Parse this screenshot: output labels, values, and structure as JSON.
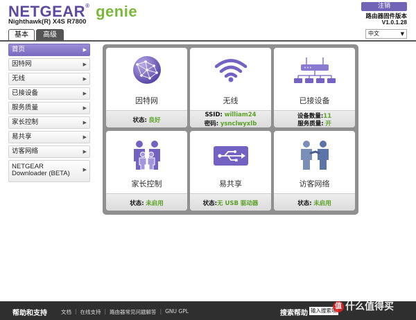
{
  "header": {
    "brand": "NETGEAR",
    "brand_reg": "®",
    "brand_genie": "genie",
    "model": "Nighthawk(R) X4S R7800",
    "logout": "注销",
    "firmware_label": "路由器固件版本",
    "firmware_version": "V1.0.1.28",
    "language": "中文"
  },
  "tabs": [
    {
      "label": "基本",
      "active": true
    },
    {
      "label": "高级",
      "active": false
    }
  ],
  "sidebar": {
    "items": [
      {
        "label": "首页",
        "active": true
      },
      {
        "label": "因特网"
      },
      {
        "label": "无线"
      },
      {
        "label": "已接设备"
      },
      {
        "label": "服务质量"
      },
      {
        "label": "家长控制"
      },
      {
        "label": "易共享"
      },
      {
        "label": "访客网络"
      },
      {
        "label_line1": "NETGEAR",
        "label_line2": "Downloader (BETA)"
      }
    ]
  },
  "tiles": {
    "internet": {
      "title": "因特网",
      "status_key": "状态:",
      "status_value": "良好",
      "icon": "globe-icon"
    },
    "wireless": {
      "title": "无线",
      "ssid_key": "SSID:",
      "ssid_value": "william24",
      "pwd_key": "密码:",
      "pwd_value": "ysnclwyxlb",
      "icon": "wifi-icon"
    },
    "devices": {
      "title": "已接设备",
      "count_key": "设备数量:",
      "count_value": "11",
      "qos_key": "服务质量:",
      "qos_value": "开",
      "icon": "router-icon"
    },
    "parental": {
      "title": "家长控制",
      "status_key": "状态:",
      "status_value": "未启用",
      "icon": "family-icon"
    },
    "share": {
      "title": "易共享",
      "status_key": "状态:",
      "status_value": "无 USB 驱动器",
      "icon": "usb-icon"
    },
    "guest": {
      "title": "访客网络",
      "status_key": "状态:",
      "status_value": "未启用",
      "icon": "guest-people-icon"
    }
  },
  "footer": {
    "help_title": "帮助和支持",
    "links": [
      "文档",
      "在线支持",
      "路由器常见问题解答",
      "GNU GPL"
    ],
    "search_label": "搜索帮助",
    "search_placeholder": "输入搜索项"
  },
  "watermark": {
    "text": "值 什么值得买",
    "glyph": "值"
  },
  "colors": {
    "accent": "#7a6bc0",
    "status_green": "#5aa226",
    "footer_bg": "#2f2f2f",
    "panel_bg": "#8f8f8f"
  }
}
